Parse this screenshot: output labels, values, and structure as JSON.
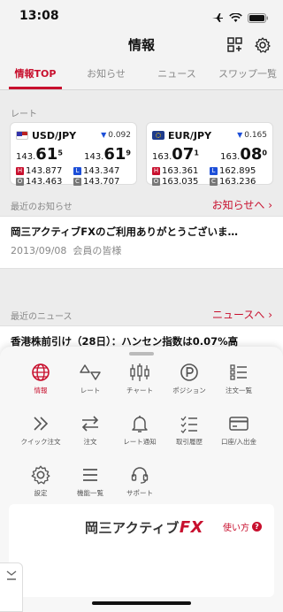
{
  "status": {
    "time": "13:08"
  },
  "nav": {
    "title": "情報"
  },
  "tabs": [
    {
      "label": "情報TOP",
      "active": true
    },
    {
      "label": "お知らせ"
    },
    {
      "label": "ニュース"
    },
    {
      "label": "スワップ一覧"
    }
  ],
  "rates": {
    "section_label": "レート",
    "cards": [
      {
        "pair": "USD/JPY",
        "change": "0.092",
        "direction": "down",
        "bid_main": "143.",
        "bid_big": "61",
        "bid_sup": "5",
        "ask_main": "143.",
        "ask_big": "61",
        "ask_sup": "9",
        "high": "143.877",
        "low": "143.347",
        "open": "143.463",
        "close": "143.707"
      },
      {
        "pair": "EUR/JPY",
        "change": "0.165",
        "direction": "down",
        "bid_main": "163.",
        "bid_big": "07",
        "bid_sup": "1",
        "ask_main": "163.",
        "ask_big": "08",
        "ask_sup": "0",
        "high": "163.361",
        "low": "162.895",
        "open": "163.035",
        "close": "163.236"
      }
    ],
    "badge_h": "H",
    "badge_l": "L",
    "badge_o": "O",
    "badge_c": "C"
  },
  "notices": {
    "label": "最近のお知らせ",
    "link": "お知らせへ ›",
    "title": "岡三アクティブFXのご利用ありがとうございま…",
    "date": "2013/09/08",
    "audience": "会員の皆様"
  },
  "news": {
    "label": "最近のニュース",
    "link": "ニュースへ ›",
    "title": "香港株前引け（28日）：ハンセン指数は0.07%高"
  },
  "menu": {
    "items": [
      {
        "label": "情報",
        "icon": "globe-icon",
        "active": true
      },
      {
        "label": "レート",
        "icon": "rate-triangles-icon"
      },
      {
        "label": "チャート",
        "icon": "candlestick-icon"
      },
      {
        "label": "ポジション",
        "icon": "position-p-icon"
      },
      {
        "label": "注文一覧",
        "icon": "order-list-icon"
      },
      {
        "label": "クイック注文",
        "icon": "double-chevron-icon"
      },
      {
        "label": "注文",
        "icon": "swap-arrows-icon"
      },
      {
        "label": "レート通知",
        "icon": "bell-icon"
      },
      {
        "label": "取引履歴",
        "icon": "checklist-icon"
      },
      {
        "label": "口座/入出金",
        "icon": "card-icon"
      },
      {
        "label": "設定",
        "icon": "gear-icon"
      },
      {
        "label": "機能一覧",
        "icon": "hamburger-icon"
      },
      {
        "label": "サポート",
        "icon": "headset-icon"
      }
    ]
  },
  "banner": {
    "logo_text": "岡三アクティブ",
    "logo_fx": "FX",
    "help_label": "使い方",
    "help_icon": "?"
  },
  "colors": {
    "accent": "#c8102e",
    "blue": "#1d4fd8"
  }
}
